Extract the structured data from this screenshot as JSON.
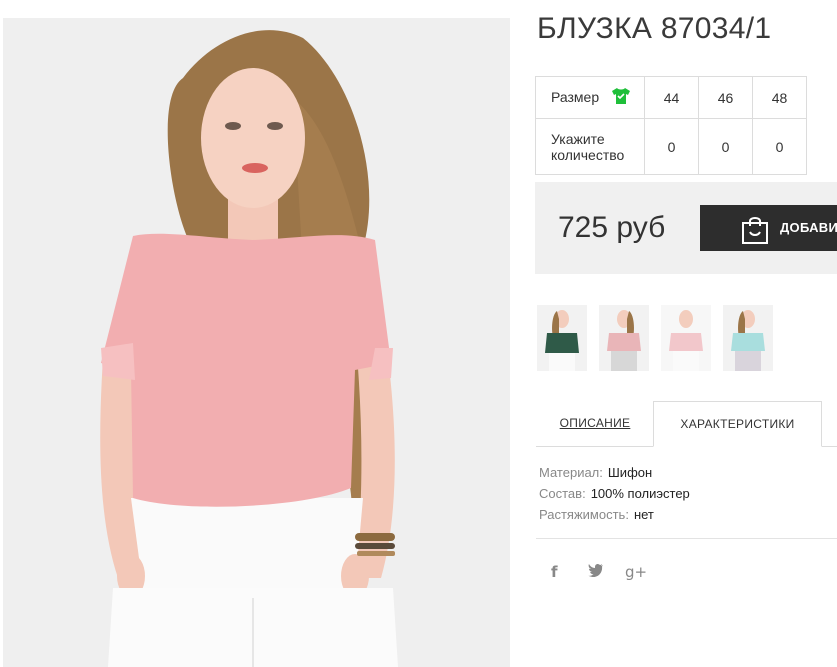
{
  "product": {
    "title": "БЛУЗКА 87034/1",
    "image": "model-pink-blouse-photo",
    "price": "725 руб",
    "add_to_cart_label": "ДОБАВИТ",
    "add_to_cart_icon": "shopping-bag-icon"
  },
  "size_table": {
    "size_label": "Размер",
    "size_icon": "tshirt-icon",
    "size_icon_color": "#1fbf3a",
    "qty_label_line1": "Укажите",
    "qty_label_line2": "количество",
    "sizes": [
      "44",
      "46",
      "48"
    ],
    "quantities": [
      "0",
      "0",
      "0"
    ]
  },
  "thumbnails": [
    {
      "name": "model-dark-green-blouse-thumb",
      "color": "#2f5a48"
    },
    {
      "name": "model-pink-blouse-thumb-front",
      "color": "#e9b5b8"
    },
    {
      "name": "model-pink-blouse-thumb-back",
      "color": "#f2c7cb"
    },
    {
      "name": "model-mint-blouse-thumb",
      "color": "#a9dede"
    }
  ],
  "tabs": {
    "description": "ОПИСАНИЕ",
    "characteristics": "ХАРАКТЕРИСТИКИ",
    "active": "characteristics"
  },
  "specs": [
    {
      "key": "Материал:",
      "value": "Шифон"
    },
    {
      "key": "Состав:",
      "value": "100% полиэстер"
    },
    {
      "key": "Растяжимость:",
      "value": "нет"
    }
  ],
  "social": {
    "facebook": "f",
    "twitter": "t",
    "google_plus": "g+"
  },
  "colors": {
    "button_bg": "#2d2d2d",
    "price_box_bg": "#f0f0f0",
    "border": "#dcdcdc"
  }
}
